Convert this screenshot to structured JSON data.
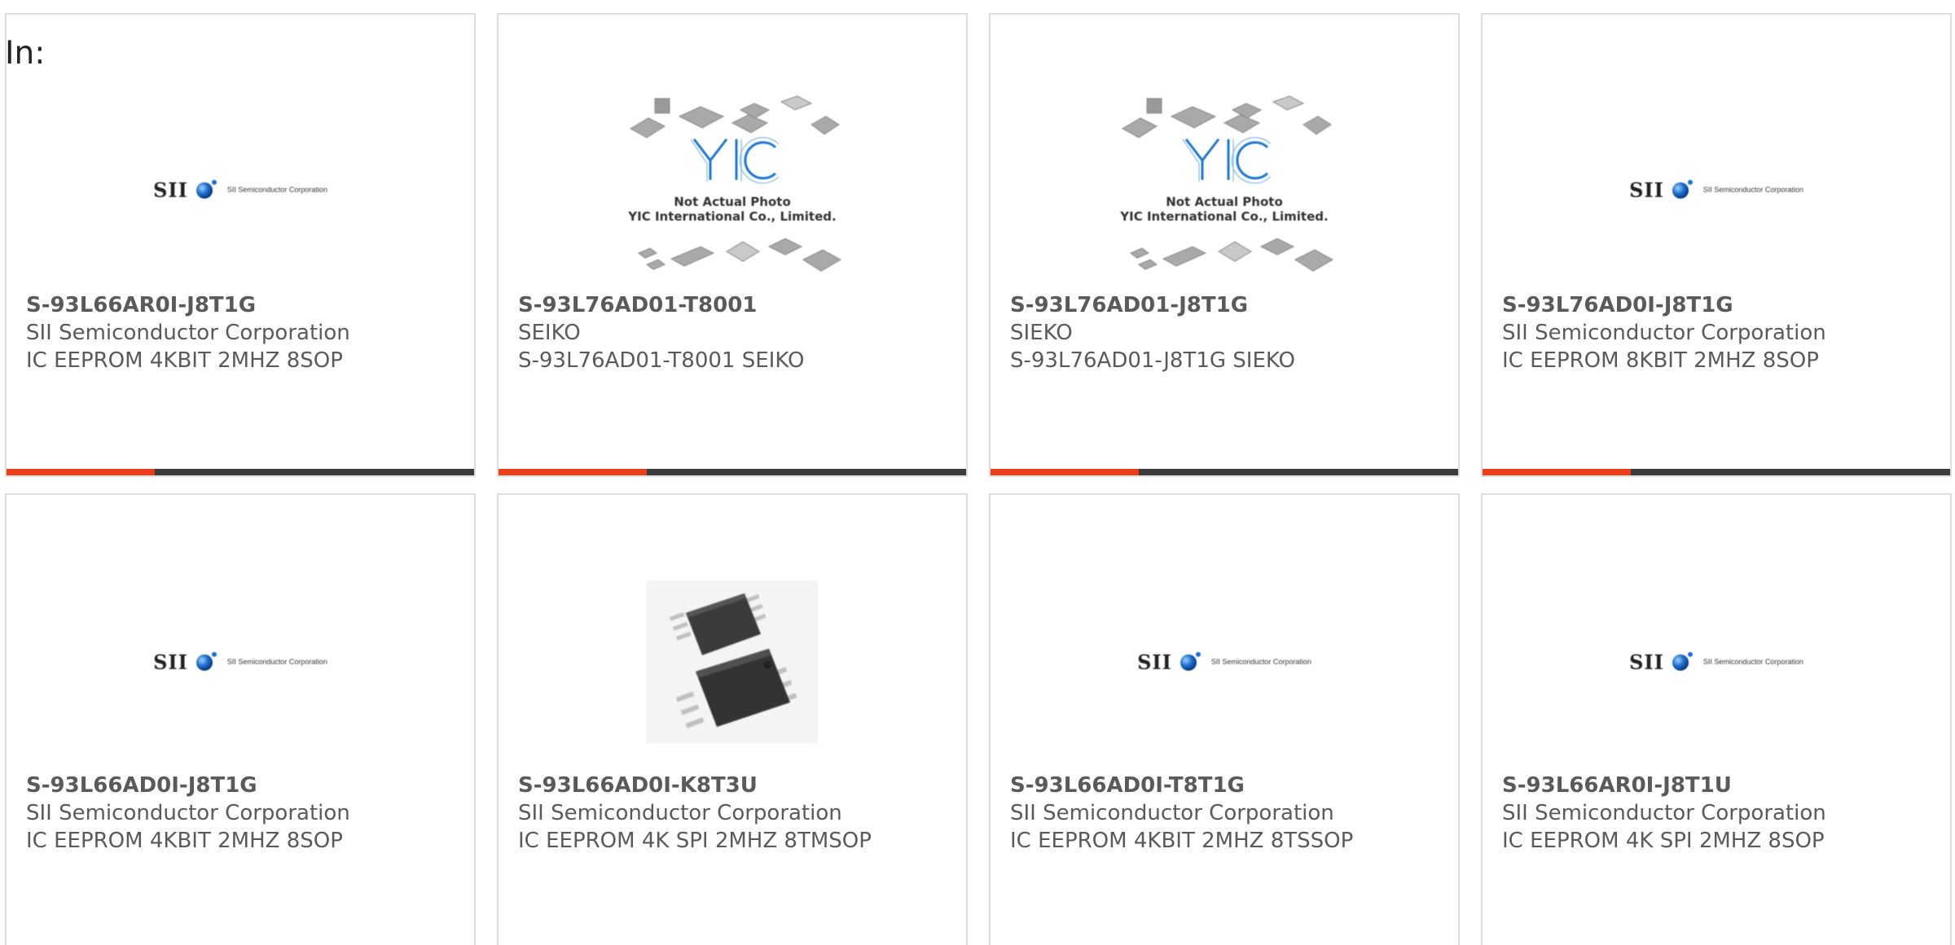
{
  "header": {
    "in_label": "In:"
  },
  "logos": {
    "sii_word": "SII",
    "sii_corp": "SII Semiconductor Corporation",
    "yic_brand": "YIC",
    "yic_line1": "Not Actual Photo",
    "yic_line2": "YIC International Co., Limited."
  },
  "colors": {
    "accent": "#e8401a",
    "bar": "#3c3c3c",
    "border": "#dcdcdc",
    "text": "#5a5a5a"
  },
  "products": [
    {
      "image": "sii-logo",
      "part_number": "S-93L66AR0I-J8T1G",
      "manufacturer": "SII Semiconductor Corporation",
      "description": "IC EEPROM 4KBIT 2MHZ 8SOP"
    },
    {
      "image": "yic-placeholder",
      "part_number": "S-93L76AD01-T8001",
      "manufacturer": "SEIKO",
      "description": "S-93L76AD01-T8001 SEIKO"
    },
    {
      "image": "yic-placeholder",
      "part_number": "S-93L76AD01-J8T1G",
      "manufacturer": "SIEKO",
      "description": "S-93L76AD01-J8T1G SIEKO"
    },
    {
      "image": "sii-logo",
      "part_number": "S-93L76AD0I-J8T1G",
      "manufacturer": "SII Semiconductor Corporation",
      "description": "IC EEPROM 8KBIT 2MHZ 8SOP"
    },
    {
      "image": "sii-logo",
      "part_number": "S-93L66AD0I-J8T1G",
      "manufacturer": "SII Semiconductor Corporation",
      "description": "IC EEPROM 4KBIT 2MHZ 8SOP"
    },
    {
      "image": "chip-photo",
      "part_number": "S-93L66AD0I-K8T3U",
      "manufacturer": "SII Semiconductor Corporation",
      "description": "IC EEPROM 4K SPI 2MHZ 8TMSOP"
    },
    {
      "image": "sii-logo",
      "part_number": "S-93L66AD0I-T8T1G",
      "manufacturer": "SII Semiconductor Corporation",
      "description": "IC EEPROM 4KBIT 2MHZ 8TSSOP"
    },
    {
      "image": "sii-logo",
      "part_number": "S-93L66AR0I-J8T1U",
      "manufacturer": "SII Semiconductor Corporation",
      "description": "IC EEPROM 4K SPI 2MHZ 8SOP"
    }
  ]
}
